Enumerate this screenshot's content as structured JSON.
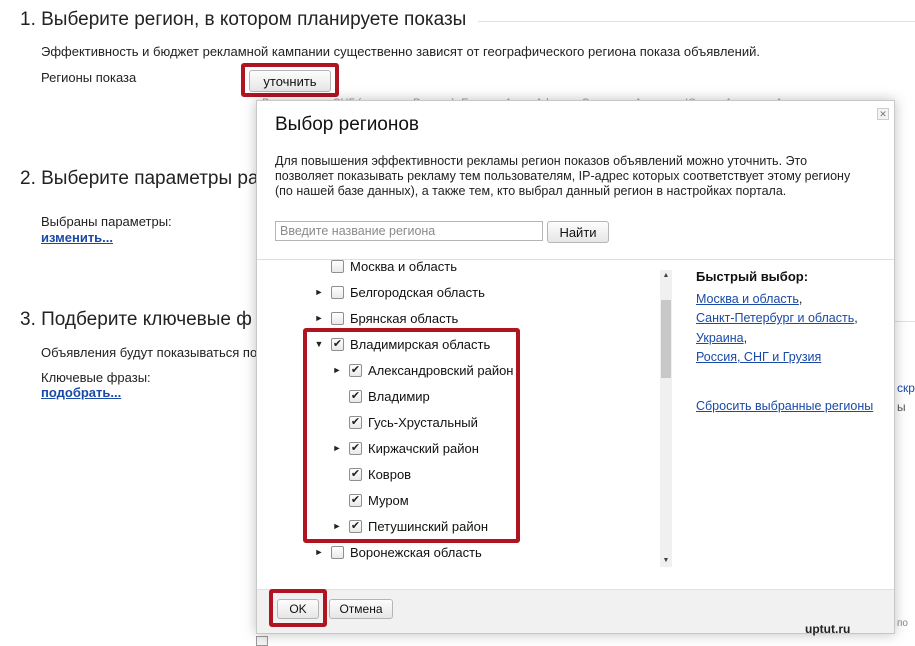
{
  "section1": {
    "title": "1. Выберите регион, в котором планируете показы",
    "description": "Эффективность и бюджет рекламной кампании существенно зависят от географического региона показа объявлений.",
    "regions_label": "Регионы показа",
    "refine_button": "уточнить",
    "regions_list": "Все регионы, СНГ (исключая Россию), Европа, Азия, Африка, Северная Америка, Южная Америка, Австралия и"
  },
  "section2": {
    "title": "2. Выберите параметры ра",
    "selected_label": "Выбраны параметры:",
    "change_link": "изменить..."
  },
  "section3": {
    "title": "3. Подберите ключевые ф",
    "desc": "Объявления будут показываться по",
    "phrases_label": "Ключевые фразы:",
    "pick_link": "подобрать...",
    "right_fragment_1": "скры",
    "right_fragment_2": "ы"
  },
  "dialog": {
    "title": "Выбор регионов",
    "close_icon": "close-icon",
    "description": "Для повышения эффективности рекламы регион показов объявлений можно уточнить. Это позволяет показывать рекламу тем пользователям, IP-адрес которых соответствует этому региону (по нашей базе данных), а также тем, кто выбрал данный регион в настройках портала.",
    "search_placeholder": "Введите название региона",
    "search_value": "",
    "find_button": "Найти",
    "tree": [
      {
        "label": "Москва и область",
        "expander": false,
        "checked": false,
        "level": 0
      },
      {
        "label": "Белгородская область",
        "expander": "collapsed",
        "checked": false,
        "level": 0
      },
      {
        "label": "Брянская область",
        "expander": "collapsed",
        "checked": false,
        "level": 0
      },
      {
        "label": "Владимирская область",
        "expander": "expanded",
        "checked": true,
        "level": 0
      },
      {
        "label": "Александровский район",
        "expander": "collapsed",
        "checked": true,
        "level": 1
      },
      {
        "label": "Владимир",
        "expander": false,
        "checked": true,
        "level": 1
      },
      {
        "label": "Гусь-Хрустальный",
        "expander": false,
        "checked": true,
        "level": 1
      },
      {
        "label": "Киржачский район",
        "expander": "collapsed",
        "checked": true,
        "level": 1
      },
      {
        "label": "Ковров",
        "expander": false,
        "checked": true,
        "level": 1
      },
      {
        "label": "Муром",
        "expander": false,
        "checked": true,
        "level": 1
      },
      {
        "label": "Петушинский район",
        "expander": "collapsed",
        "checked": true,
        "level": 1
      },
      {
        "label": "Воронежская область",
        "expander": "collapsed",
        "checked": false,
        "level": 0
      }
    ],
    "quick_title": "Быстрый выбор:",
    "quick_links": [
      "Москва и область",
      "Санкт-Петербург и область",
      "Украина",
      "Россия, СНГ и Грузия"
    ],
    "reset_link": "Сбросить выбранные регионы",
    "ok_button": "OK",
    "cancel_button": "Отмена"
  },
  "bottom": {
    "fragment": "по"
  },
  "watermark": "uptut.ru",
  "colors": {
    "highlight_frame": "#b01421",
    "link": "#1a4aa8"
  }
}
